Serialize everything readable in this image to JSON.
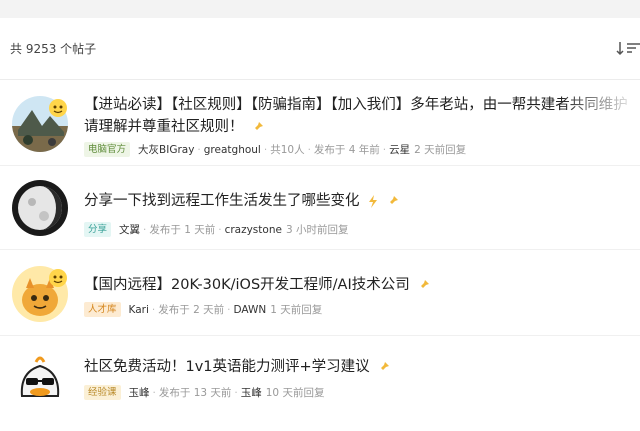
{
  "header": {
    "count_text": "共 9253 个帖子"
  },
  "posts": [
    {
      "title_line1": "【进站必读】【社区规则】【防骗指南】【加入我们】多年老站，由一帮共建者共同维护",
      "title_line2": "请理解并尊重社区规则！",
      "tag": "电脑官方",
      "author": "大灰BIGray",
      "last_replier": "greatghoul",
      "participants": "共10人",
      "posted": "发布于 4 年前",
      "reply_user": "云星",
      "reply_time": "2 天前回复"
    },
    {
      "title": "分享一下找到远程工作生活发生了哪些变化",
      "tag": "分享",
      "author": "文翼",
      "posted": "发布于 1 天前",
      "reply_user": "crazystone",
      "reply_time": "3 小时前回复"
    },
    {
      "title": "【国内远程】20K-30K/iOS开发工程师/AI技术公司",
      "tag": "人才库",
      "author": "Kari",
      "posted": "发布于 2 天前",
      "reply_user": "DAWN",
      "reply_time": "1 天前回复"
    },
    {
      "title": "社区免费活动！1v1英语能力测评+学习建议",
      "tag": "经验课",
      "author": "玉峰",
      "posted": "发布于 13 天前",
      "reply_user": "玉峰",
      "reply_time": "10 天前回复"
    }
  ],
  "colors": {
    "pin": "#f2b93b",
    "bolt": "#f2b93b",
    "tag_official": "#5f8c3a",
    "tag_share": "#3aa198",
    "tag_talent": "#d4861e",
    "tag_exp": "#b98a2a"
  },
  "icons": {
    "sort": "sort-icon",
    "pin": "pin-icon",
    "hot": "bolt-icon"
  }
}
